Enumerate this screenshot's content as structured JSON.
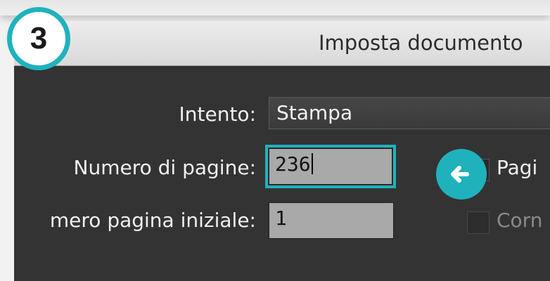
{
  "step_badge": {
    "number": "3"
  },
  "window": {
    "title": "Imposta documento"
  },
  "form": {
    "intent_label": "Intento:",
    "intent_value": "Stampa",
    "pages_label": "Numero di pagine:",
    "pages_value": "236",
    "start_label": "mero pagina iniziale:",
    "start_value": "1",
    "facing_pages_label": "Pagi",
    "primary_text_frame_label": "Corn"
  },
  "colors": {
    "accent": "#1fb2bd",
    "dialog_bg": "#333333",
    "field_bg": "#a9a9a9"
  },
  "icons": {
    "callout": "arrow-left-icon"
  }
}
